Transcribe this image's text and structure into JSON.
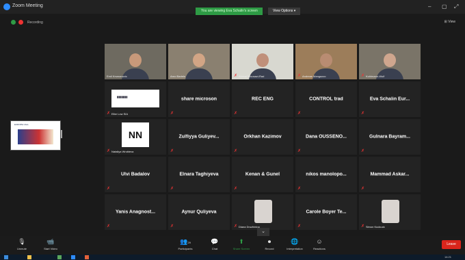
{
  "window": {
    "title": "Zoom Meeting",
    "controls": [
      "–",
      "▢",
      "⤢"
    ]
  },
  "share_banner": {
    "message": "You are viewing Eva Schalin's screen",
    "options_label": "View Options ▾"
  },
  "recording": {
    "label": "Recording"
  },
  "view_button": "⊞ View",
  "tiles": [
    {
      "id": "t1",
      "type": "video",
      "caption": "Emil Krsmanovic",
      "muted": false
    },
    {
      "id": "t2",
      "type": "video",
      "caption": "Arno Bartels",
      "muted": false,
      "active": true
    },
    {
      "id": "t3",
      "type": "video",
      "caption": "Ahmad Moosavi-Rad",
      "muted": true
    },
    {
      "id": "t4",
      "type": "video",
      "caption": "Andreas Mangazzo",
      "muted": true
    },
    {
      "id": "t5",
      "type": "video",
      "caption": "Kohlmann-Wulf",
      "muted": true
    },
    {
      "id": "t6",
      "type": "logo",
      "caption": "Elbe Low SIA",
      "muted": true
    },
    {
      "id": "t7",
      "type": "name",
      "name": "share microson",
      "muted": true
    },
    {
      "id": "t8",
      "type": "name",
      "name": "REC ENG",
      "muted": true
    },
    {
      "id": "t9",
      "type": "name",
      "name": "CONTROL trad",
      "muted": true
    },
    {
      "id": "t10",
      "type": "name",
      "name": "Eva Schalin Eur...",
      "muted": true
    },
    {
      "id": "t11",
      "type": "nn",
      "caption": "Nataliya Wrobleva",
      "muted": true
    },
    {
      "id": "t12",
      "type": "name",
      "name": "Zulfiyya Guliyev...",
      "muted": true
    },
    {
      "id": "t13",
      "type": "name",
      "name": "Orkhan Kazimov",
      "muted": true
    },
    {
      "id": "t14",
      "type": "name",
      "name": "Dana OUSSENO...",
      "muted": true
    },
    {
      "id": "t15",
      "type": "name",
      "name": "Gulnara Bayram...",
      "muted": true
    },
    {
      "id": "t16",
      "type": "name",
      "name": "Ulvi Badalov",
      "muted": true
    },
    {
      "id": "t17",
      "type": "name",
      "name": "Elnara Taghiyeva",
      "muted": true
    },
    {
      "id": "t18",
      "type": "name",
      "name": "Kenan & Gunel",
      "muted": true
    },
    {
      "id": "t19",
      "type": "name",
      "name": "nikos manolopo...",
      "muted": true
    },
    {
      "id": "t20",
      "type": "name",
      "name": "Mammad Askar...",
      "muted": true
    },
    {
      "id": "t21",
      "type": "name",
      "name": "Yanis Anagnost...",
      "muted": true
    },
    {
      "id": "t22",
      "type": "name",
      "name": "Aynur Quliyeva",
      "muted": true
    },
    {
      "id": "t23",
      "type": "avatar",
      "caption": "Diana Druzhinina",
      "muted": true
    },
    {
      "id": "t24",
      "type": "name",
      "name": "Carole Boyer Te...",
      "muted": true
    },
    {
      "id": "t25",
      "type": "avatar",
      "caption": "Simon Kuckuck",
      "muted": true
    }
  ],
  "shared_screen": {
    "title": "EUROPE CALL"
  },
  "toolbar": {
    "unmute": "Unmute",
    "start_video": "Start Video",
    "participants": "Participants",
    "participants_count": "29",
    "chat": "Chat",
    "share_screen": "Share Screen",
    "record": "Record",
    "interpretation": "Interpretation",
    "reactions": "Reactions",
    "end": "Leave"
  },
  "tray": {
    "time": "14:21"
  },
  "colors": {
    "share_green": "#2e9b45",
    "end_red": "#d9251c",
    "active_outline": "#c9d83a"
  }
}
